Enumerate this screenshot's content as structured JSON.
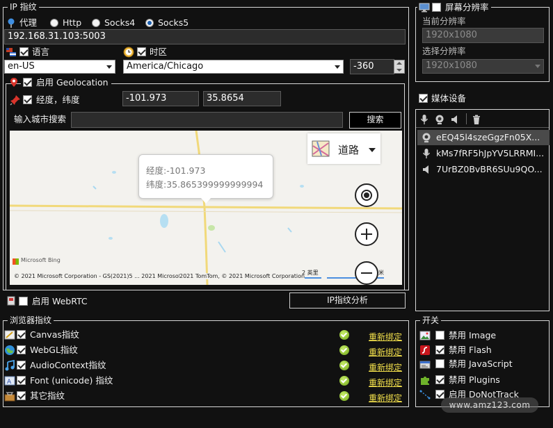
{
  "ip_group": {
    "title": "IP 指纹",
    "proxy_label": "代理",
    "proxy_types": [
      "Http",
      "Socks4",
      "Socks5"
    ],
    "selected_type": "Socks5",
    "proxy_value": "192.168.31.103:5003"
  },
  "language": {
    "label": "语言",
    "value": "en-US"
  },
  "timezone": {
    "label": "时区",
    "value": "America/Chicago",
    "offset": "-360"
  },
  "geolocation": {
    "title": "启用 Geolocation",
    "coord_label": "经度，纬度",
    "longitude": "-101.973",
    "latitude": "35.8654",
    "search_label": "输入城市搜索",
    "search_value": "",
    "search_button": "搜索"
  },
  "map": {
    "style_label": "道路",
    "tooltip_lng": "经度:-101.973",
    "tooltip_lat": "纬度:35.865399999999994",
    "brand": "Microsoft Bing",
    "copyright": "© 2021 Microsoft Corporation - GS(2021)5 ... 2021 Microsoft Corporation",
    "copyright_tail": "2021 TomTom, © 2021 Microsoft Corporation",
    "scale_label": "2 英里",
    "scale_label_km": "米"
  },
  "webrtc": {
    "label": "启用 WebRTC",
    "analysis_button": "IP指纹分析"
  },
  "resolution": {
    "title": "屏幕分辨率",
    "current_label": "当前分辨率",
    "current_value": "1920x1080",
    "select_label": "选择分辨率",
    "select_value": "1920x1080"
  },
  "media": {
    "title": "媒体设备",
    "items": [
      "eEQ45l4szeGgzFn05X...",
      "kMs7fRF5hJpYV5LRRMI...",
      "7UrBZ0BvBR6SUu9QO..."
    ]
  },
  "browser_fp": {
    "title": "浏览器指纹",
    "rebind": "重新绑定",
    "items": [
      "Canvas指纹",
      "WebGL指纹",
      "AudioContext指纹",
      "Font (unicode) 指纹",
      "其它指纹"
    ]
  },
  "switches": {
    "title": "开关",
    "items": [
      "禁用 Image",
      "禁用 Flash",
      "禁用 JavaScript",
      "禁用 Plugins",
      "启用 DoNotTrack"
    ]
  },
  "watermark": "www.amz123.com",
  "colors": {
    "accent_link": "#f5e24c",
    "ok_green": "#7ab51d",
    "map_road": "#f1d97a",
    "map_bg": "#f3f2ee"
  }
}
